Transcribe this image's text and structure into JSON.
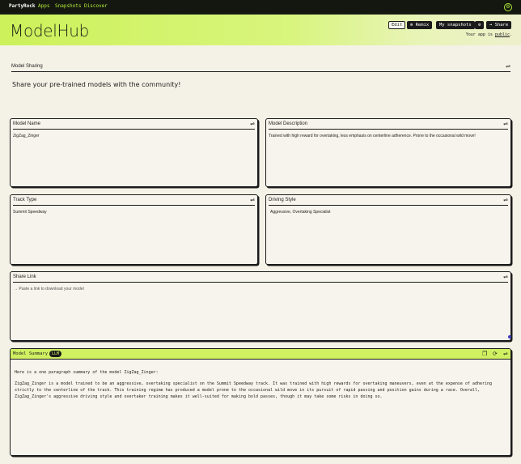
{
  "nav": {
    "brand": "PartyRock",
    "links": [
      "Apps",
      "Snapshots",
      "Discover"
    ],
    "settings_icon": "settings-icon"
  },
  "header": {
    "title": "ModelHub",
    "buttons": {
      "edit": "Edit",
      "remix": "⊚ Remix",
      "snapshots": "My snapshots",
      "gear": "⚙",
      "share": "→ Share"
    },
    "visibility_prefix": "Your app is",
    "visibility_link": "public",
    "visibility_suffix": "."
  },
  "section": {
    "label": "Model Sharing",
    "intro": "Share your pre-trained models with the community!"
  },
  "cards": {
    "model_name": {
      "label": "Model Name",
      "value": "ZigZag_Zinger"
    },
    "model_description": {
      "label": "Model Description",
      "value": "Trained with high reward for overtaking, less emphasis on centerline adherence. Prone to the occasional wild move!"
    },
    "track_type": {
      "label": "Track Type",
      "value": "Summit Speedway"
    },
    "driving_style": {
      "label": "Driving Style",
      "value": "Aggressive, Overtaking Specialist"
    },
    "share_link": {
      "label": "Share Link",
      "placeholder": "→ Paste a link to download your model"
    }
  },
  "summary": {
    "label": "Model Summary",
    "badge": "LLM",
    "intro": "Here is a one paragraph summary of the model ZigZag_Zinger:",
    "paragraph": "ZigZag_Zinger is a model trained to be an aggressive, overtaking specialist on the Summit Speedway track. It was trained with high rewards for overtaking maneuvers, even at the expense of adhering strictly to the centerline of the track. This training regime has produced a model prone to the occasional wild move in its pursuit of rapid passing and position gains during a race. Overall, ZigZag_Zinger's aggressive driving style and overtaker training makes it well-suited for making bold passes, though it may take some risks in doing so."
  },
  "icons": {
    "settings": "⇌",
    "copy": "❐",
    "refresh": "⟳"
  }
}
